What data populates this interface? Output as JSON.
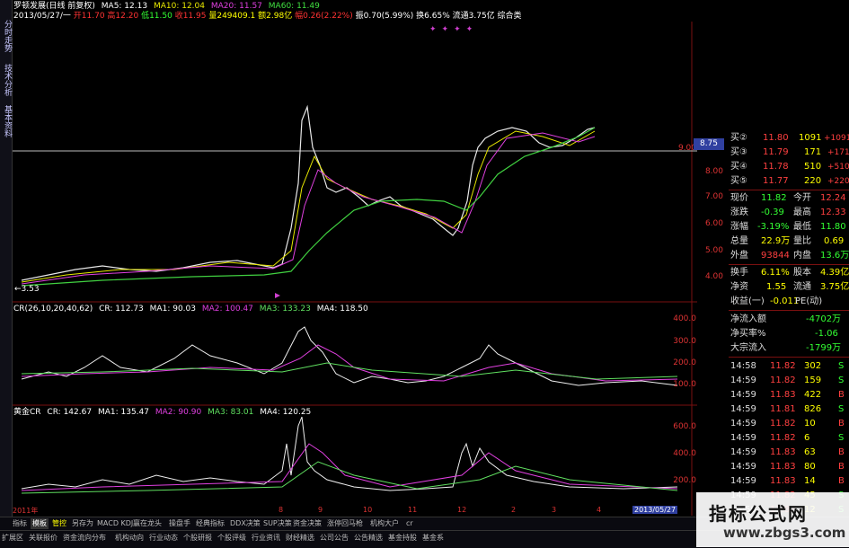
{
  "left_tabs": [
    "分时走势",
    "技术分析",
    "基本资料"
  ],
  "header": {
    "line1": "罗顿发展(日线 前复权)",
    "ma5": "MA5: 12.13",
    "ma10": "MA10: 12.04",
    "ma20": "MA20: 11.57",
    "ma60": "MA60: 11.49",
    "date": "2013/05/27/一",
    "open": "开11.70",
    "high": "高12.20",
    "low": "低11.50",
    "close": "收11.95",
    "vol": "量249409.1",
    "amt": "额2.98亿",
    "chg": "幅0.26(2.22%)",
    "amp": "振0.70(5.99%)",
    "turn": "换6.65%",
    "float": "流通3.75亿",
    "cat": "综合类"
  },
  "main_chart": {
    "low_label": "←3.53",
    "y_labels": [
      "9.00",
      "8.00",
      "7.00",
      "6.00",
      "5.00",
      "4.00"
    ],
    "price_marker": "8.75"
  },
  "cr_panel": {
    "title": "CR(26,10,20,40,62)",
    "cr": "CR: 112.73",
    "ma1": "MA1: 90.03",
    "ma2": "MA2: 100.47",
    "ma3": "MA3: 133.23",
    "ma4": "MA4: 118.50",
    "y_labels": [
      "400.0",
      "300.0",
      "200.0",
      "100.0"
    ]
  },
  "gold_panel": {
    "title": "黄金CR",
    "cr": "CR: 142.67",
    "ma1": "MA1: 135.47",
    "ma2": "MA2: 90.90",
    "ma3": "MA3: 83.01",
    "ma4": "MA4: 120.25",
    "y_labels": [
      "600.0",
      "400.0",
      "200.0"
    ]
  },
  "x_axis": [
    "2011年",
    "8",
    "9",
    "10",
    "11",
    "12",
    "2",
    "3",
    "4"
  ],
  "x_date": "2013/05/27",
  "quotes": [
    {
      "label": "买②",
      "price": "11.80",
      "vol": "1091",
      "chg": "+1091"
    },
    {
      "label": "买③",
      "price": "11.79",
      "vol": "171",
      "chg": "+171"
    },
    {
      "label": "买④",
      "price": "11.78",
      "vol": "510",
      "chg": "+510"
    },
    {
      "label": "买⑤",
      "price": "11.77",
      "vol": "220",
      "chg": "+220"
    }
  ],
  "stats": [
    {
      "a": "现价",
      "av": "11.82",
      "b": "今开",
      "bv": "12.24"
    },
    {
      "a": "涨跌",
      "av": "-0.39",
      "b": "最高",
      "bv": "12.33"
    },
    {
      "a": "涨幅",
      "av": "-3.19%",
      "b": "最低",
      "bv": "11.80"
    },
    {
      "a": "总量",
      "av": "22.9万",
      "b": "量比",
      "bv": "0.69"
    },
    {
      "a": "外盘",
      "av": "93844",
      "b": "内盘",
      "bv": "13.6万"
    },
    {
      "a": "换手",
      "av": "6.11%",
      "b": "股本",
      "bv": "4.39亿"
    },
    {
      "a": "净资",
      "av": "1.55",
      "b": "流通",
      "bv": "3.75亿"
    },
    {
      "a": "收益(一)",
      "av": "-0.011",
      "b": "PE(动)",
      "bv": ""
    }
  ],
  "flows": [
    {
      "label": "净流入额",
      "value": "-4702万"
    },
    {
      "label": "净买率%",
      "value": "-1.06"
    },
    {
      "label": "大宗流入",
      "value": "-1799万"
    }
  ],
  "ticks": [
    {
      "t": "14:58",
      "p": "11.82",
      "v": "302",
      "s": "S"
    },
    {
      "t": "14:59",
      "p": "11.82",
      "v": "159",
      "s": "S"
    },
    {
      "t": "14:59",
      "p": "11.83",
      "v": "422",
      "s": "B"
    },
    {
      "t": "14:59",
      "p": "11.81",
      "v": "826",
      "s": "S"
    },
    {
      "t": "14:59",
      "p": "11.82",
      "v": "10",
      "s": "B"
    },
    {
      "t": "14:59",
      "p": "11.82",
      "v": "6",
      "s": "S"
    },
    {
      "t": "14:59",
      "p": "11.83",
      "v": "63",
      "s": "B"
    },
    {
      "t": "14:59",
      "p": "11.83",
      "v": "80",
      "s": "B"
    },
    {
      "t": "14:59",
      "p": "11.83",
      "v": "14",
      "s": "B"
    },
    {
      "t": "14:59",
      "p": "11.82",
      "v": "45",
      "s": "S"
    },
    {
      "t": "14:59",
      "p": "11.82",
      "v": "12",
      "s": "S"
    }
  ],
  "toolbar": [
    "指标",
    "模板",
    "管控",
    "另存为",
    "MACD KDJ",
    "赢在龙头",
    "操盘手",
    "经典指标",
    "DDX决策",
    "SUP决策",
    "资金决策",
    "涨停回马枪",
    "机构大户",
    "cr"
  ],
  "bottom_bar": [
    "扩展区",
    "关联报价",
    "资金流向分布",
    "机构动向",
    "行业动态",
    "个股研报",
    "个股评级",
    "行业资讯",
    "财经精选",
    "公司公告",
    "公告精选",
    "基金持股",
    "基金系"
  ],
  "watermark": {
    "title": "指标公式网",
    "url": "www.zbgs3.com"
  }
}
